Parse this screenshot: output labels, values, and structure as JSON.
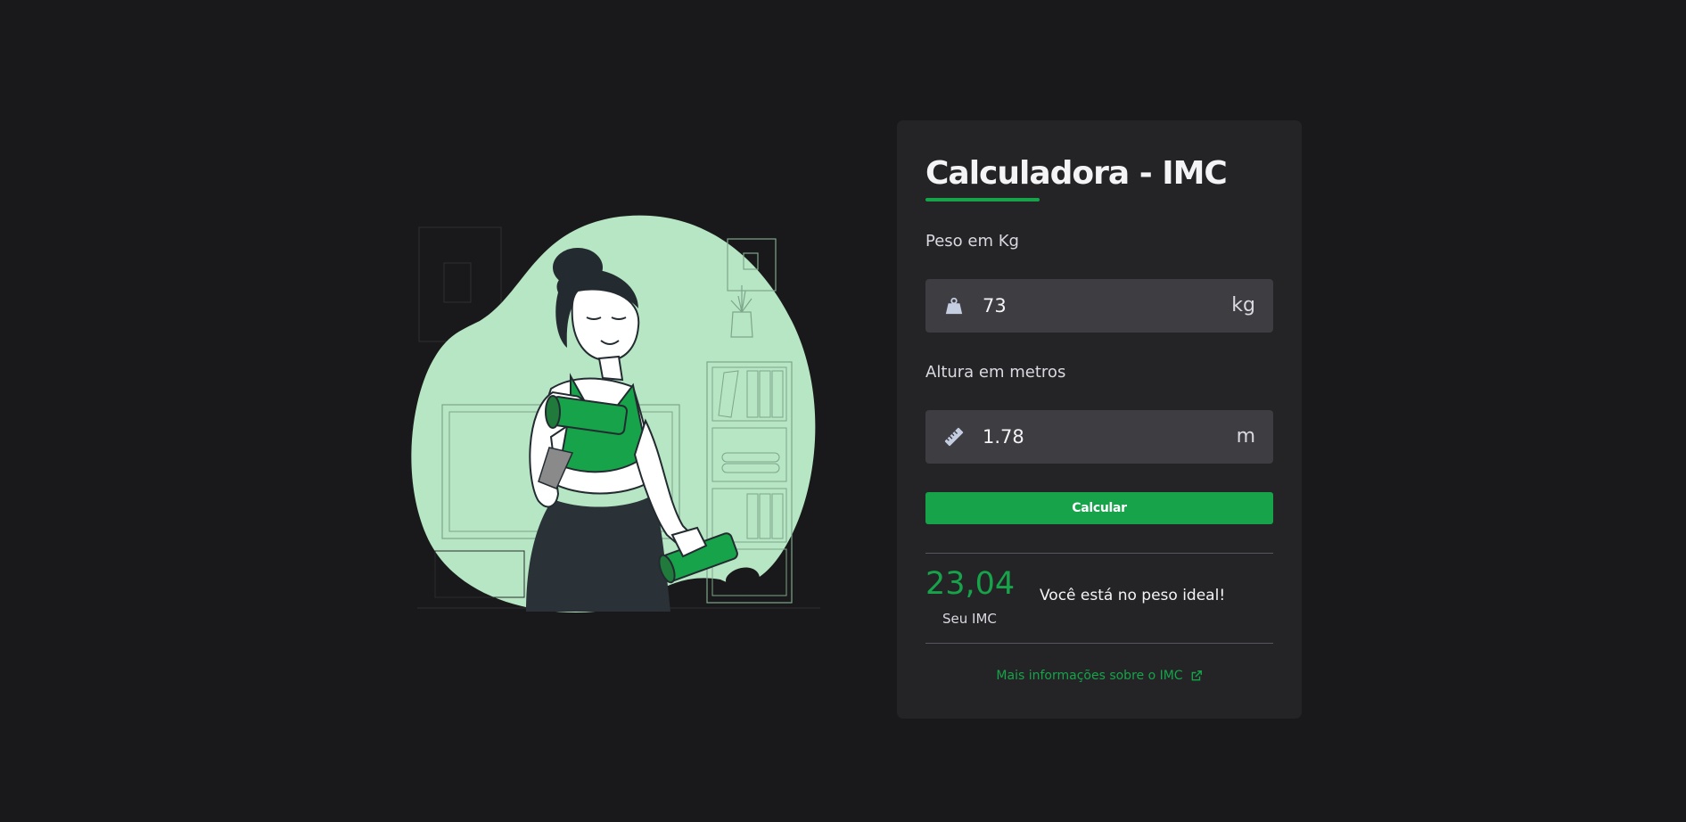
{
  "card": {
    "title": "Calculadora - IMC",
    "weight": {
      "label": "Peso em Kg",
      "value": "73",
      "unit": "kg",
      "icon": "weight-icon"
    },
    "height": {
      "label": "Altura em metros",
      "value": "1.78",
      "unit": "m",
      "icon": "ruler-icon"
    },
    "calculate_label": "Calcular",
    "result": {
      "value": "23,04",
      "caption": "Seu IMC",
      "message": "Você está no peso ideal!"
    },
    "more_info_label": "Mais informações sobre o IMC",
    "more_info_icon": "external-link-icon"
  },
  "colors": {
    "accent": "#16a34a",
    "background": "#19191b",
    "card": "#242426",
    "input": "#3d3d42",
    "illustration_bg": "#b7e6c4"
  }
}
